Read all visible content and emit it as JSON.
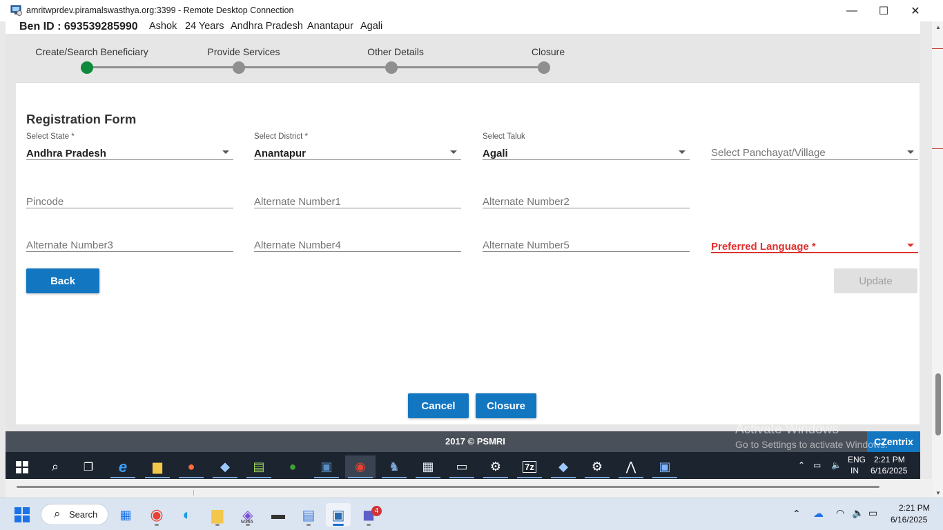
{
  "rdp": {
    "title": "amritwprdev.piramalswasthya.org:3399 - Remote Desktop Connection",
    "minimize": "—",
    "maximize": "☐",
    "close": "✕"
  },
  "beneficiary": {
    "ben_id": "Ben ID : 693539285990",
    "name": "Ashok",
    "age": "24 Years",
    "state": "Andhra Pradesh",
    "district": "Anantapur",
    "taluk": "Agali"
  },
  "stepper": {
    "steps": [
      {
        "label": "Create/Search Beneficiary",
        "active": true
      },
      {
        "label": "Provide Services",
        "active": false
      },
      {
        "label": "Other Details",
        "active": false
      },
      {
        "label": "Closure",
        "active": false
      }
    ]
  },
  "form": {
    "title": "Registration Form",
    "state": {
      "label": "Select State *",
      "value": "Andhra Pradesh"
    },
    "district": {
      "label": "Select District *",
      "value": "Anantapur"
    },
    "taluk": {
      "label": "Select Taluk",
      "value": "Agali"
    },
    "village": {
      "placeholder": "Select Panchayat/Village"
    },
    "pincode": {
      "placeholder": "Pincode"
    },
    "alt1": {
      "placeholder": "Alternate Number1"
    },
    "alt2": {
      "placeholder": "Alternate Number2"
    },
    "alt3": {
      "placeholder": "Alternate Number3"
    },
    "alt4": {
      "placeholder": "Alternate Number4"
    },
    "alt5": {
      "placeholder": "Alternate Number5"
    },
    "language": {
      "placeholder": "Preferred Language *"
    },
    "back_label": "Back",
    "update_label": "Update",
    "cancel_label": "Cancel",
    "closure_label": "Closure"
  },
  "footer": {
    "copyright": "2017 © PSMRI",
    "brand": "CZentrix"
  },
  "remote_taskbar": {
    "lang": "ENG",
    "region": "IN",
    "time": "2:21 PM",
    "date": "6/16/2025",
    "activate_title": "Activate Windows",
    "activate_sub": "Go to Settings to activate Windows."
  },
  "host_taskbar": {
    "search_label": "Search",
    "m365_label": "M365",
    "teams_badge": "4",
    "time": "2:21 PM",
    "date": "6/16/2025"
  },
  "colors": {
    "primary_blue": "#1376c1",
    "active_step": "#0f8a3c",
    "error_red": "#e0312f"
  }
}
